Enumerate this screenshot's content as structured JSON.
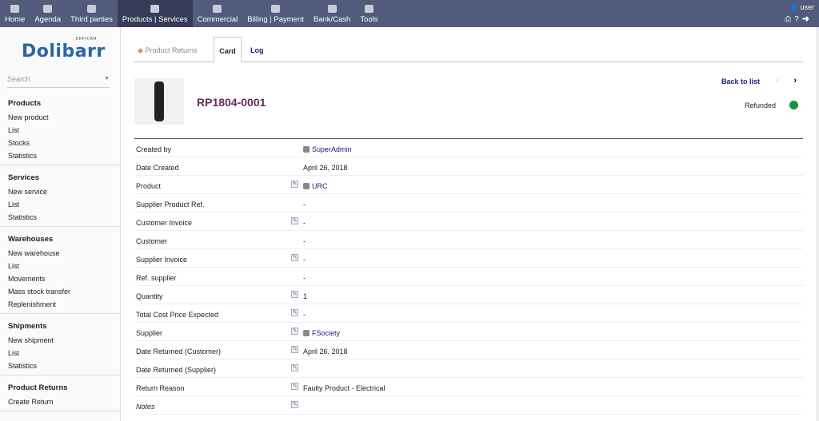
{
  "topnav": [
    {
      "label": "Home"
    },
    {
      "label": "Agenda"
    },
    {
      "label": "Third parties"
    },
    {
      "label": "Products | Services",
      "active": true
    },
    {
      "label": "Commercial"
    },
    {
      "label": "Billing | Payment"
    },
    {
      "label": "Bank/Cash"
    },
    {
      "label": "Tools"
    }
  ],
  "user": "user",
  "logo": {
    "name": "Dolibarr",
    "tag": "ERP/CRM"
  },
  "search_placeholder": "Search",
  "sidebar": [
    {
      "title": "Products",
      "items": [
        "New product",
        "List",
        "Stocks",
        "Statistics"
      ]
    },
    {
      "title": "Services",
      "items": [
        "New service",
        "List",
        "Statistics"
      ]
    },
    {
      "title": "Warehouses",
      "items": [
        "New warehouse",
        "List",
        "Movements",
        "Mass stock transfer",
        "Replenishment"
      ]
    },
    {
      "title": "Shipments",
      "items": [
        "New shipment",
        "List",
        "Statistics"
      ]
    },
    {
      "title": "Product Returns",
      "items": [
        "Create Return"
      ]
    }
  ],
  "tabs": {
    "module": "Product Returns",
    "card": "Card",
    "log": "Log"
  },
  "record": {
    "ref": "RP1804-0001",
    "back": "Back to list",
    "prev": "‹",
    "next": "›",
    "status": "Refunded",
    "status_color": "#11943a"
  },
  "fields": [
    {
      "label": "Created by",
      "value": "SuperAdmin",
      "link": true,
      "icon": "user",
      "edit": false
    },
    {
      "label": "Date Created",
      "value": "April 26, 2018",
      "edit": false
    },
    {
      "label": "Product",
      "value": "URC",
      "link": true,
      "icon": "product",
      "edit": true
    },
    {
      "label": "Supplier Product Ref.",
      "value": "-",
      "edit": false
    },
    {
      "label": "Customer Invoice",
      "value": "-",
      "edit": true
    },
    {
      "label": "Customer",
      "value": "-",
      "edit": false
    },
    {
      "label": "Supplier Invoice",
      "value": "-",
      "edit": true
    },
    {
      "label": "Ref. supplier",
      "value": "-",
      "edit": false
    },
    {
      "label": "Quantity",
      "value": "1",
      "edit": true
    },
    {
      "label": "Total Cost Price Expected",
      "value": "-",
      "edit": true
    },
    {
      "label": "Supplier",
      "value": "FSociety",
      "link": true,
      "icon": "company",
      "edit": true
    },
    {
      "label": "Date Returned (Customer)",
      "value": "April 26, 2018",
      "edit": true
    },
    {
      "label": "Date Returned (Supplier)",
      "value": "",
      "edit": true
    },
    {
      "label": "Return Reason",
      "value": "Faulty Product - Electrical",
      "edit": true
    },
    {
      "label": "Notes",
      "value": "",
      "edit": true,
      "italic": true
    }
  ]
}
